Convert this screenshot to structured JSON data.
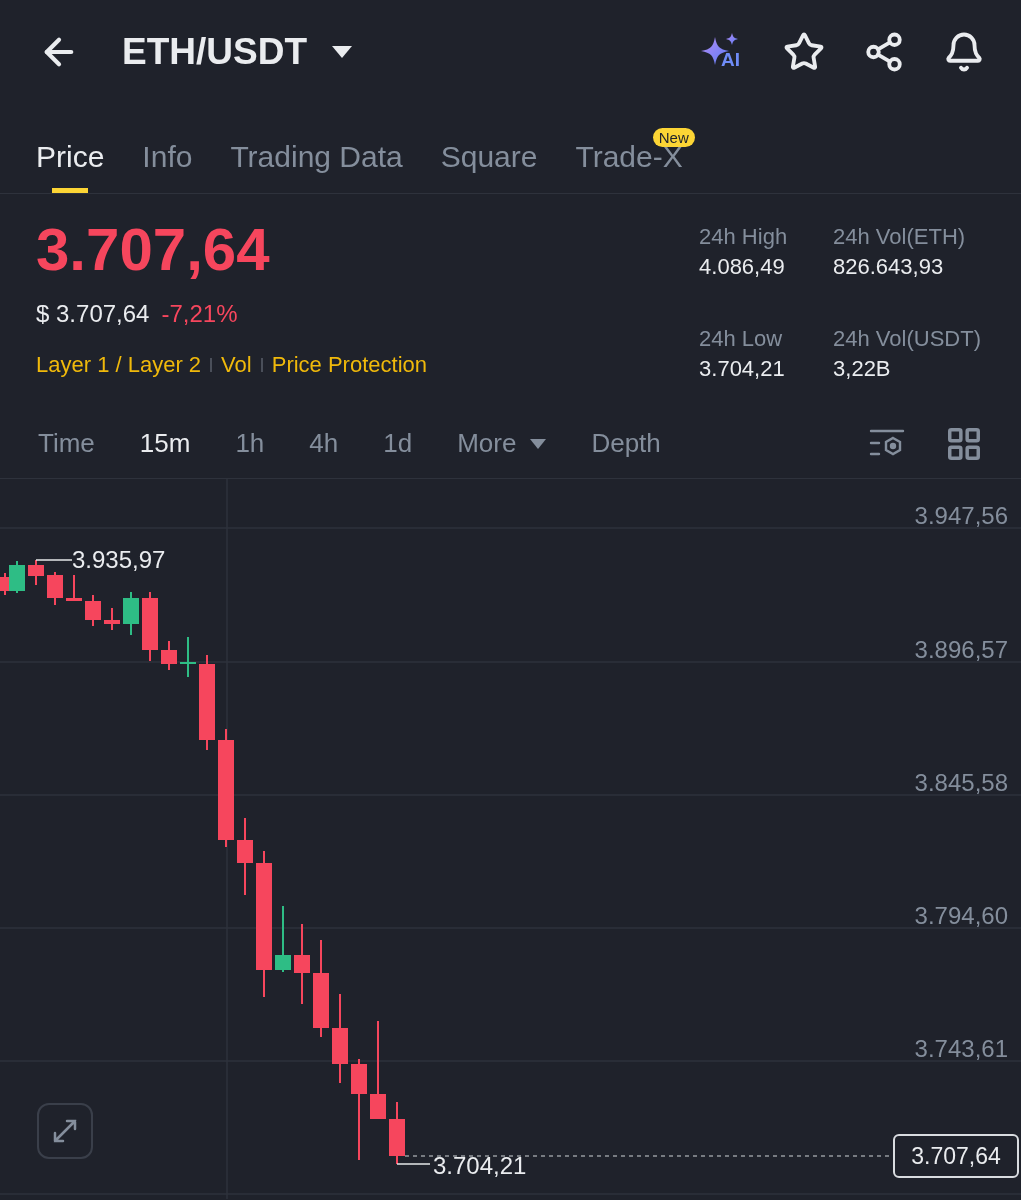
{
  "header": {
    "title": "ETH/USDT",
    "ai_label": "AI"
  },
  "tabs": [
    {
      "label": "Price",
      "selected": true
    },
    {
      "label": "Info",
      "selected": false
    },
    {
      "label": "Trading Data",
      "selected": false
    },
    {
      "label": "Square",
      "selected": false
    },
    {
      "label": "Trade-X",
      "selected": false,
      "badge": "New"
    }
  ],
  "price": {
    "last": "3.707,64",
    "fiat": "$ 3.707,64",
    "change": "-7,21%",
    "tags": [
      "Layer 1 / Layer 2",
      "Vol",
      "Price Protection"
    ]
  },
  "stats": [
    {
      "label": "24h High",
      "value": "4.086,49"
    },
    {
      "label": "24h Vol(ETH)",
      "value": "826.643,93"
    },
    {
      "label": "24h Low",
      "value": "3.704,21"
    },
    {
      "label": "24h Vol(USDT)",
      "value": "3,22B"
    }
  ],
  "intervals": [
    {
      "label": "Time",
      "selected": false,
      "kind": "interval"
    },
    {
      "label": "15m",
      "selected": true,
      "kind": "interval"
    },
    {
      "label": "1h",
      "selected": false,
      "kind": "interval"
    },
    {
      "label": "4h",
      "selected": false,
      "kind": "interval"
    },
    {
      "label": "1d",
      "selected": false,
      "kind": "interval"
    },
    {
      "label": "More",
      "selected": false,
      "kind": "dropdown"
    },
    {
      "label": "Depth",
      "selected": false,
      "kind": "interval"
    }
  ],
  "chart": {
    "y_labels": [
      "3.947,56",
      "3.896,57",
      "3.845,58",
      "3.794,60",
      "3.743,61"
    ],
    "high_marker": "3.935,97",
    "low_marker": "3.704,21",
    "last_price": "3.707,64"
  }
}
